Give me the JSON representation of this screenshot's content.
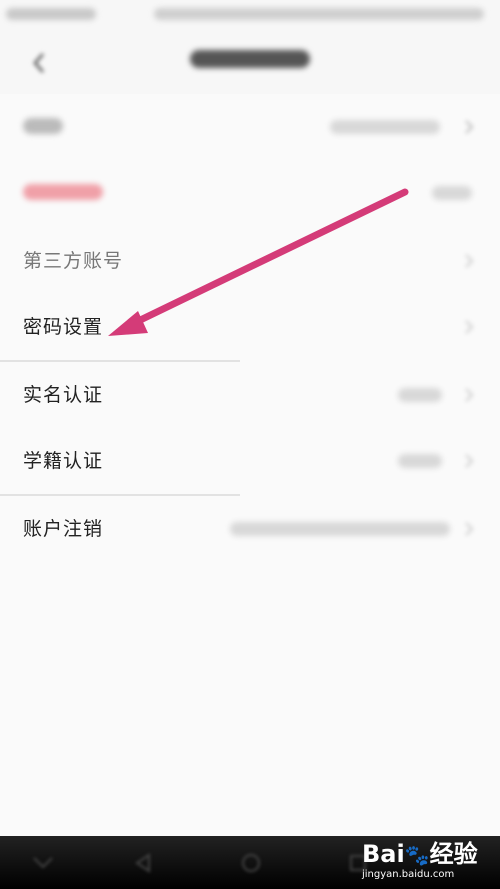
{
  "menu": {
    "items": [
      {
        "label": "第三方账号"
      },
      {
        "label": "密码设置"
      },
      {
        "label": "实名认证"
      },
      {
        "label": "学籍认证"
      },
      {
        "label": "账户注销"
      }
    ]
  },
  "watermark": {
    "brand": "Bai",
    "brand_suffix": "经验",
    "url": "jingyan.baidu.com"
  },
  "colors": {
    "annotation_arrow": "#d43b78",
    "badge_blur": "#f0a0a8"
  },
  "icons": {
    "back": "back-arrow-icon",
    "chevron": "chevron-right-icon",
    "arrow": "annotation-arrow-icon"
  }
}
